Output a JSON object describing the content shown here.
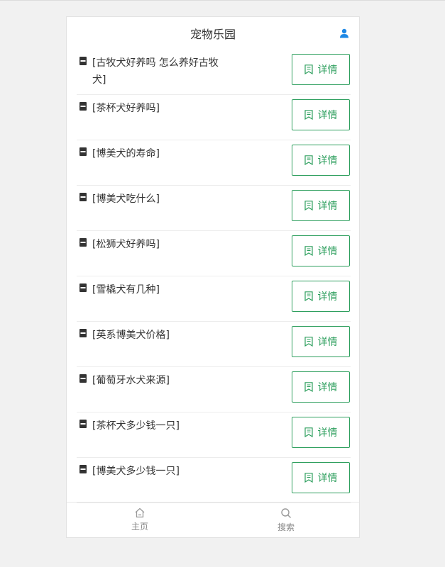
{
  "header": {
    "title": "宠物乐园",
    "user_icon": "user-icon"
  },
  "list": {
    "items": [
      {
        "text": "[古牧犬好养吗 怎么养好古牧犬]",
        "button_label": "详情"
      },
      {
        "text": "[茶杯犬好养吗]",
        "button_label": "详情"
      },
      {
        "text": "[博美犬的寿命]",
        "button_label": "详情"
      },
      {
        "text": "[博美犬吃什么]",
        "button_label": "详情"
      },
      {
        "text": "[松狮犬好养吗]",
        "button_label": "详情"
      },
      {
        "text": "[雪橇犬有几种]",
        "button_label": "详情"
      },
      {
        "text": "[英系博美犬价格]",
        "button_label": "详情"
      },
      {
        "text": "[葡萄牙水犬来源]",
        "button_label": "详情"
      },
      {
        "text": "[茶杯犬多少钱一只]",
        "button_label": "详情"
      },
      {
        "text": "[博美犬多少钱一只]",
        "button_label": "详情"
      }
    ]
  },
  "tabbar": {
    "home_label": "主页",
    "search_label": "搜索"
  },
  "colors": {
    "accent": "#2e9f5e",
    "user_icon": "#1e88e5"
  }
}
